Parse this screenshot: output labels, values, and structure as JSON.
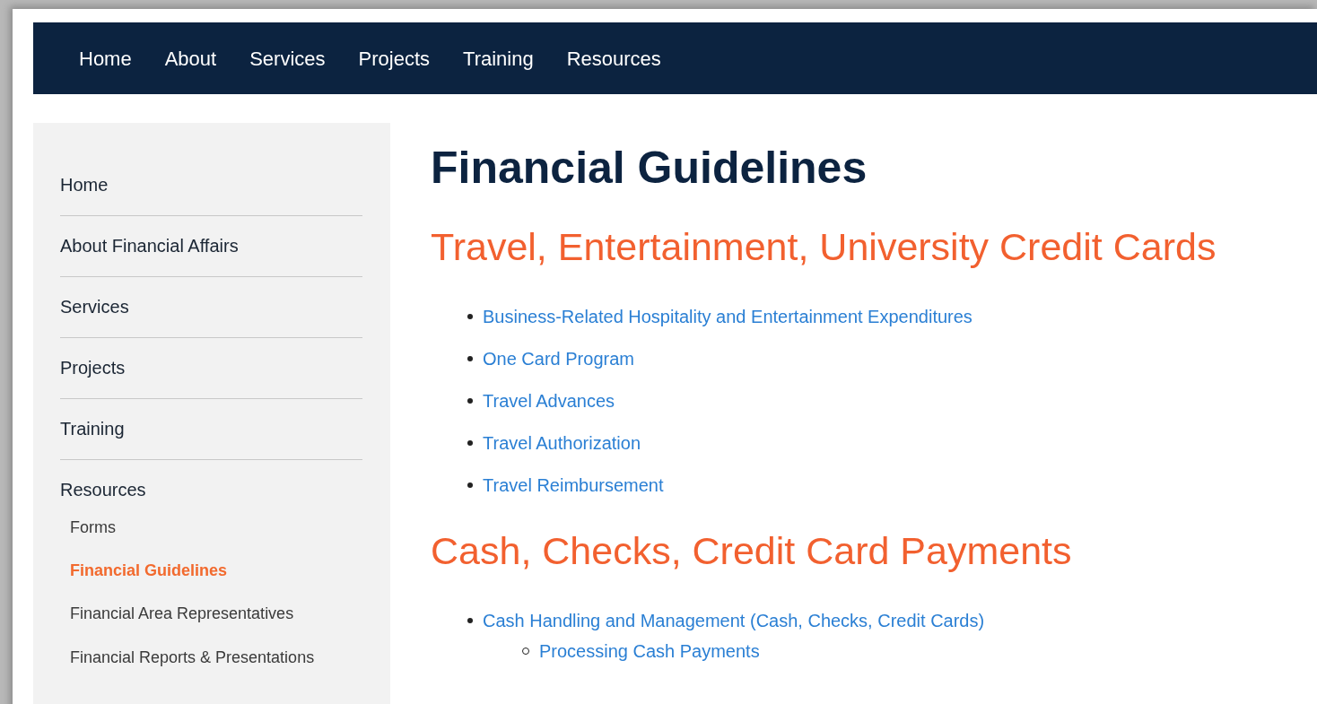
{
  "top_nav": [
    {
      "label": "Home"
    },
    {
      "label": "About"
    },
    {
      "label": "Services"
    },
    {
      "label": "Projects"
    },
    {
      "label": "Training"
    },
    {
      "label": "Resources"
    }
  ],
  "sidebar": {
    "items": [
      {
        "label": "Home",
        "selected": false
      },
      {
        "label": "About Financial Affairs",
        "selected": false
      },
      {
        "label": "Services",
        "selected": false
      },
      {
        "label": "Projects",
        "selected": false
      },
      {
        "label": "Training",
        "selected": false
      },
      {
        "label": "Resources",
        "selected": false,
        "children": [
          {
            "label": "Forms",
            "selected": false
          },
          {
            "label": "Financial Guidelines",
            "selected": true
          },
          {
            "label": "Financial Area Representatives",
            "selected": false
          },
          {
            "label": "Financial Reports & Presentations",
            "selected": false
          }
        ]
      }
    ]
  },
  "page_title": "Financial Guidelines",
  "sections": [
    {
      "heading": "Travel, Entertainment, University Credit Cards",
      "links": [
        {
          "label": "Business-Related Hospitality and Entertainment Expenditures"
        },
        {
          "label": "One Card Program"
        },
        {
          "label": "Travel Advances"
        },
        {
          "label": "Travel Authorization"
        },
        {
          "label": "Travel Reimbursement"
        }
      ]
    },
    {
      "heading": "Cash, Checks, Credit Card Payments",
      "links": [
        {
          "label": "Cash Handling and Management (Cash, Checks, Credit Cards)",
          "children": [
            {
              "label": "Processing Cash Payments"
            }
          ]
        }
      ]
    }
  ]
}
